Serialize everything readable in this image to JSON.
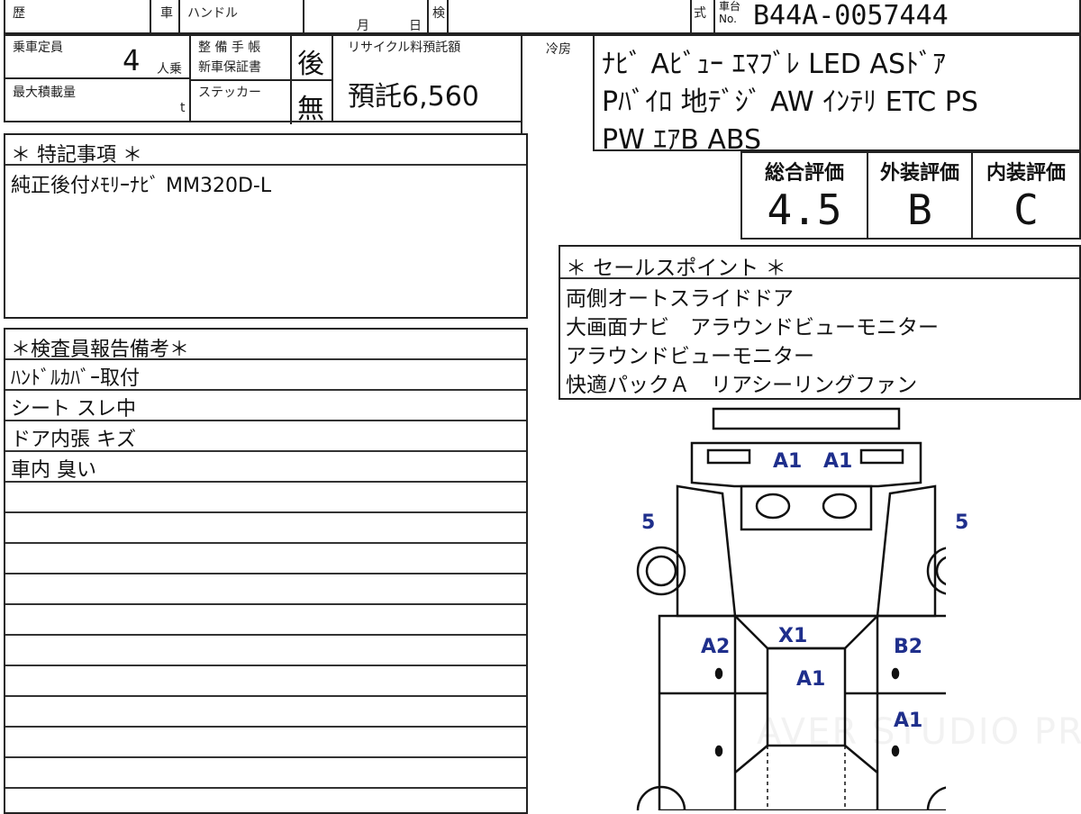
{
  "top_row": {
    "history_label": "歴",
    "car_label": "車",
    "handle_label": "ハンドル",
    "month_label": "月",
    "day_label": "日",
    "inspection_label": "検",
    "model_label": "式",
    "chassis_label": "車台",
    "chassis_no_label": "No.",
    "chassis_number": "B44A-0057444"
  },
  "capacity": {
    "label": "乗車定員",
    "value": "4",
    "unit": "人乗"
  },
  "max_load": {
    "label": "最大積載量",
    "unit": "t"
  },
  "maintenance": {
    "label1": "整 備 手 帳",
    "label2": "新車保証書",
    "value1": "後",
    "sticker_label": "ステッカー",
    "value2": "無"
  },
  "recycle": {
    "label": "リサイクル料預託額",
    "value": "預託6,560"
  },
  "cooling": {
    "label": "冷房"
  },
  "equipment_lines": [
    "ﾅﾋﾞ Aﾋﾞｭｰ ｴﾏﾌﾞﾚ LED ASﾄﾞｱ",
    "Pﾊﾞｲﾛ 地ﾃﾞｼﾞ AW ｲﾝﾃﾘ ETC PS",
    "PW ｴｱB ABS"
  ],
  "scores": {
    "overall_label": "総合評価",
    "overall": "4.5",
    "exterior_label": "外装評価",
    "exterior": "B",
    "interior_label": "内装評価",
    "interior": "C"
  },
  "special_notes": {
    "title": "＊ 特記事項 ＊",
    "text": "純正後付ﾒﾓﾘｰﾅﾋﾞ MM320D-L"
  },
  "sales_points": {
    "title": "＊ セールスポイント ＊",
    "items": [
      "両側オートスライドドア",
      "大画面ナビ　アラウンドビューモニター",
      "アラウンドビューモニター",
      "快適パックＡ　リアシーリングファン"
    ]
  },
  "inspector_report": {
    "title": "＊検査員報告備考＊",
    "items": [
      "ﾊﾝﾄﾞﾙｶﾊﾞｰ取付",
      "シート スレ中",
      "ドア内張 キズ",
      "車内 臭い"
    ]
  },
  "diagram_marks": {
    "front_left": "A1",
    "front_right": "A1",
    "left_front_wheel": "5",
    "right_front_wheel": "5",
    "windshield": "X1",
    "left_front_door": "A2",
    "roof": "A1",
    "right_front_door": "B2",
    "right_rear_door": "A1"
  },
  "watermark": "AVER STUDIO PRO"
}
